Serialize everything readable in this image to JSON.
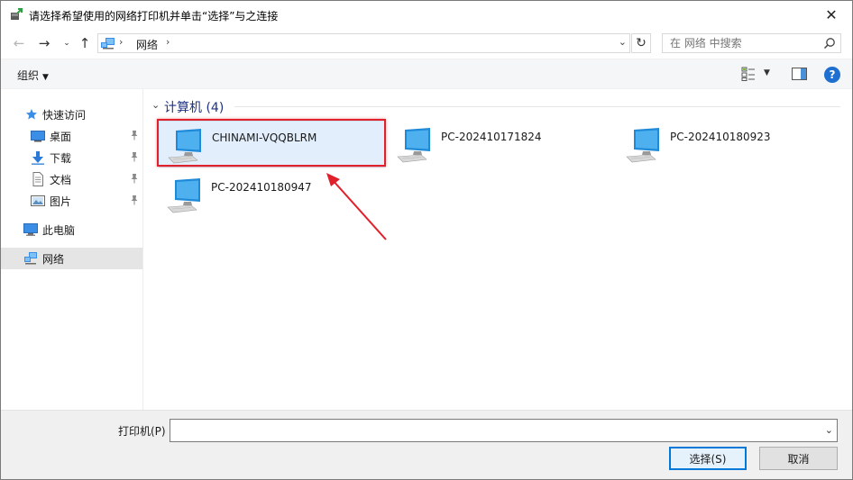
{
  "window": {
    "title": "请选择希望使用的网络打印机并单击“选择”与之连接",
    "close_label": "✕"
  },
  "address_bar": {
    "crumbs": [
      "网络"
    ],
    "search_placeholder": "在 网络 中搜索"
  },
  "command_bar": {
    "organize_label": "组织",
    "help_label": "?"
  },
  "nav_pane": {
    "quick_access_label": "快速访问",
    "quick_items": [
      {
        "label": "桌面",
        "icon": "desktop-icon"
      },
      {
        "label": "下载",
        "icon": "download-icon"
      },
      {
        "label": "文档",
        "icon": "document-icon"
      },
      {
        "label": "图片",
        "icon": "picture-icon"
      }
    ],
    "this_pc_label": "此电脑",
    "network_label": "网络"
  },
  "content": {
    "group_label": "计算机 (4)",
    "computers": [
      {
        "name": "CHINAMI-VQQBLRM",
        "selected": true
      },
      {
        "name": "PC-202410171824",
        "selected": false
      },
      {
        "name": "PC-202410180923",
        "selected": false
      },
      {
        "name": "PC-202410180947",
        "selected": false
      }
    ]
  },
  "bottom": {
    "printer_label": "打印机(P)",
    "printer_value": "",
    "select_button": "选择(S)",
    "cancel_button": "取消"
  },
  "colors": {
    "accent": "#0078d7",
    "selection_bg": "#e2eefb",
    "annotation_red": "#e0202a",
    "group_header": "#1e3287"
  }
}
